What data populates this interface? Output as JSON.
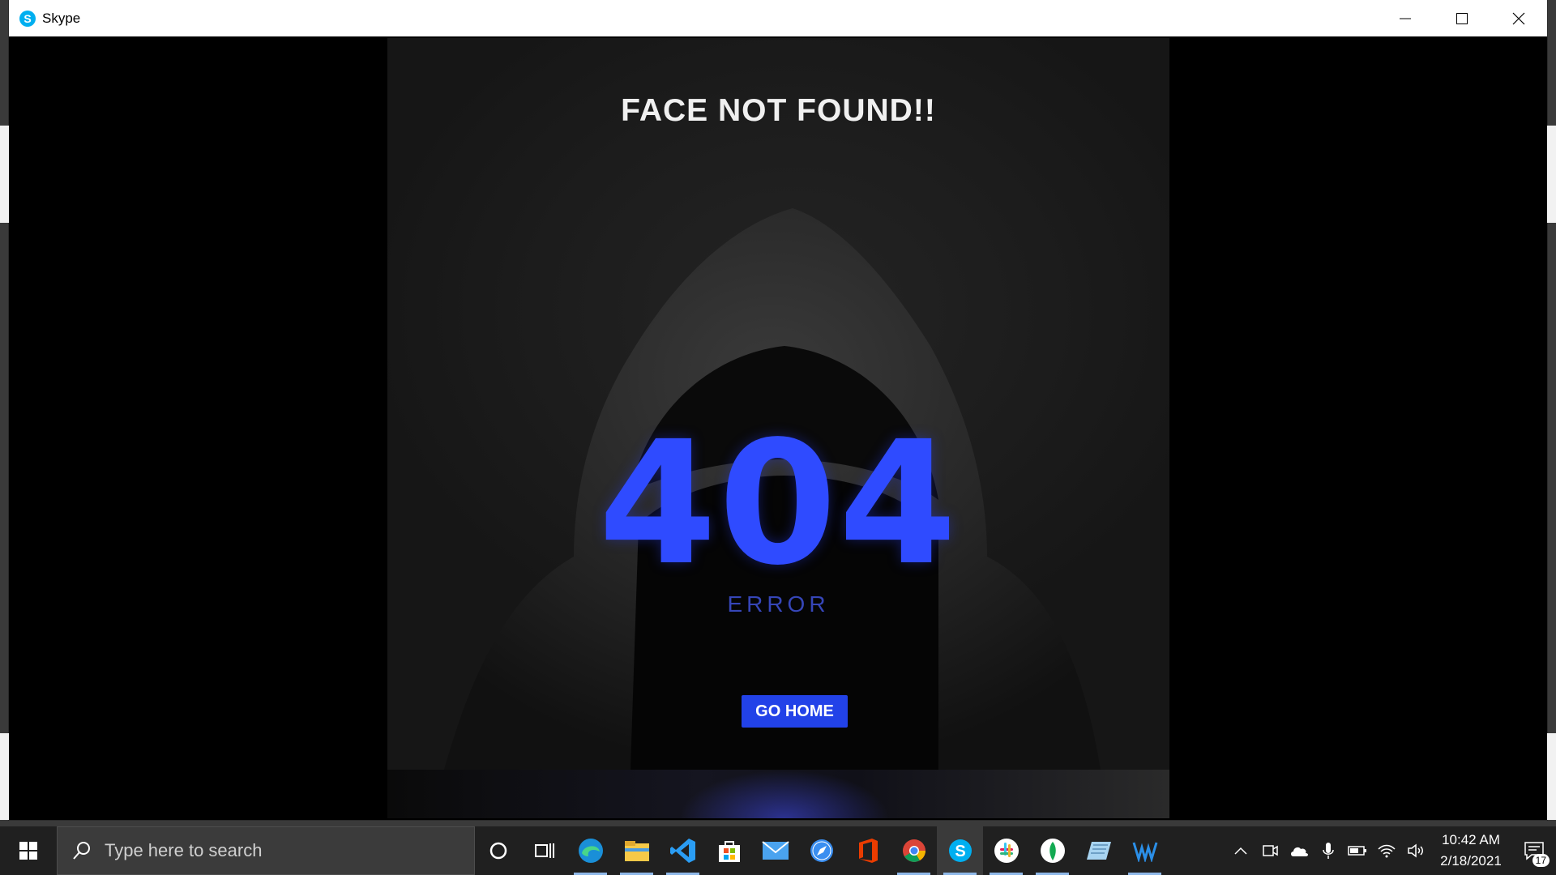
{
  "window": {
    "title": "Skype"
  },
  "poster": {
    "headline": "FACE NOT FOUND!!",
    "code": "404",
    "label": "ERROR",
    "button": "GO HOME"
  },
  "taskbar": {
    "search_placeholder": "Type here to search",
    "apps": [
      "cortana-icon",
      "task-view-icon",
      "edge-icon",
      "file-explorer-icon",
      "vscode-icon",
      "store-icon",
      "mail-icon",
      "safari-icon",
      "office-icon",
      "chrome-icon",
      "skype-icon",
      "slack-icon",
      "mongodb-icon",
      "notepad-icon",
      "waves-icon"
    ],
    "clock_time": "10:42 AM",
    "clock_date": "2/18/2021",
    "notification_count": "17"
  },
  "colors": {
    "accent": "#2f4bff",
    "button": "#2242e8",
    "skype": "#00aff0"
  }
}
